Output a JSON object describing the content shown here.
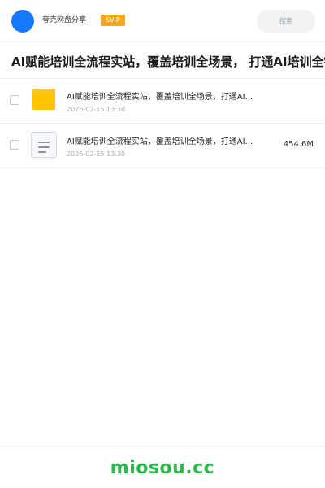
{
  "header": {
    "brand": "夸克网盘分享",
    "badge": "SVIP",
    "search_placeholder": "搜索",
    "accent_color": "#1677ff"
  },
  "share": {
    "title": "AI赋能培训全流程实站，覆盖培训全场景， 打通AI培训全链路"
  },
  "files": [
    {
      "icon": "folder-icon",
      "name": "AI赋能培训全流程实站，覆盖培训全场景，打通AI...",
      "date": "2026-02-15 13:30",
      "size": ""
    },
    {
      "icon": "document-icon",
      "name": "AI赋能培训全流程实站，覆盖培训全场景，打通AI...",
      "date": "2026-02-15 13:30",
      "size": "454.6M"
    }
  ],
  "footer": {
    "watermark": "miosou.cc",
    "watermark_color": "#2db84d"
  }
}
